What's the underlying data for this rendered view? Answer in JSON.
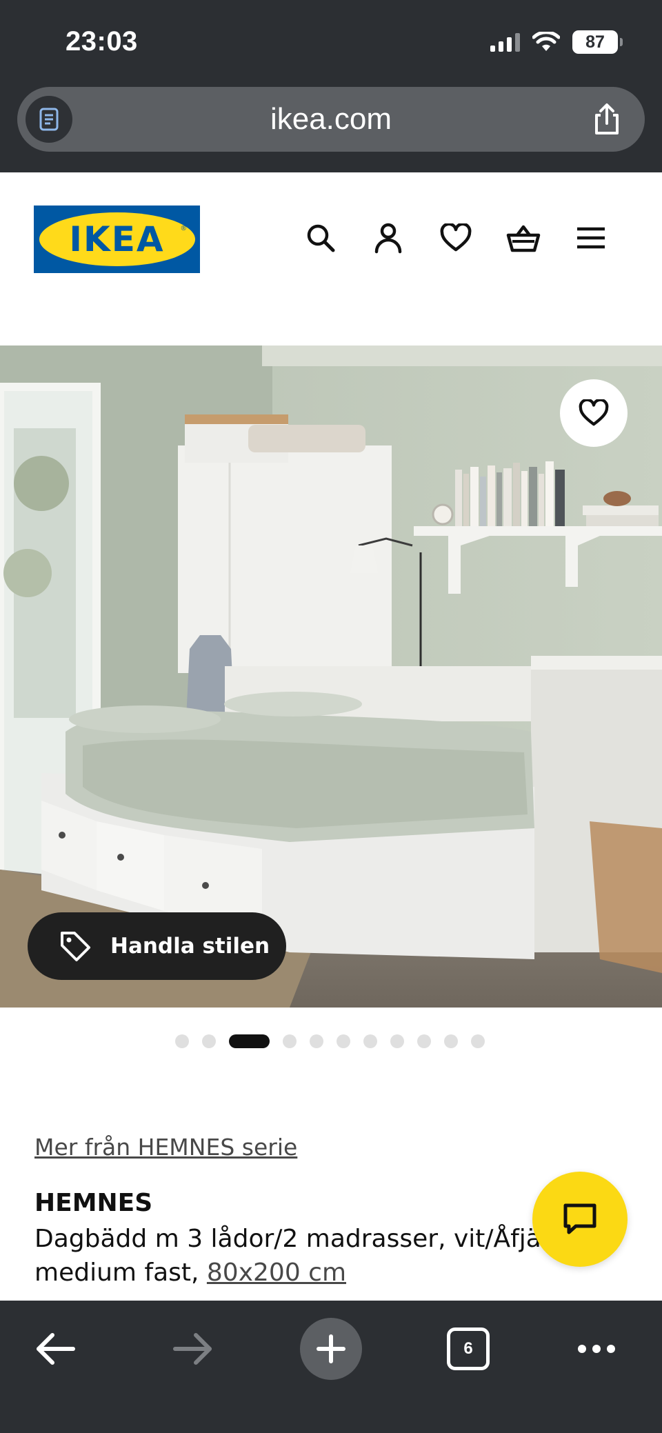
{
  "status_bar": {
    "time": "23:03",
    "battery": "87",
    "icons": [
      "cellular-signal-icon",
      "wifi-icon",
      "battery-icon"
    ]
  },
  "browser": {
    "url": "ikea.com",
    "icons": [
      "reader-icon",
      "share-icon"
    ],
    "toolbar": {
      "tab_count": "6",
      "icons": [
        "back-arrow-icon",
        "forward-arrow-icon",
        "plus-icon",
        "tabs-icon",
        "more-icon"
      ]
    }
  },
  "header": {
    "logo_text": "IKEA",
    "logo_colors": {
      "blue": "#0058a3",
      "yellow": "#ffda1a"
    },
    "icons": [
      "search-icon",
      "account-icon",
      "heart-icon",
      "basket-icon",
      "menu-icon"
    ]
  },
  "hero": {
    "shop_style_label": "Handla stilen",
    "carousel_total": 11,
    "carousel_active": 3
  },
  "product": {
    "series_link": "Mer från HEMNES serie",
    "name": "HEMNES",
    "description_line1": "Dagbädd m 3 lådor/2 madrasser, vit/Åfjä",
    "description_line2": "medium fast, ",
    "size_link": "80x200 cm"
  },
  "colors": {
    "chrome": "#2c2f33",
    "chat_button": "#fbd914",
    "text": "#111111",
    "link": "#484848"
  }
}
